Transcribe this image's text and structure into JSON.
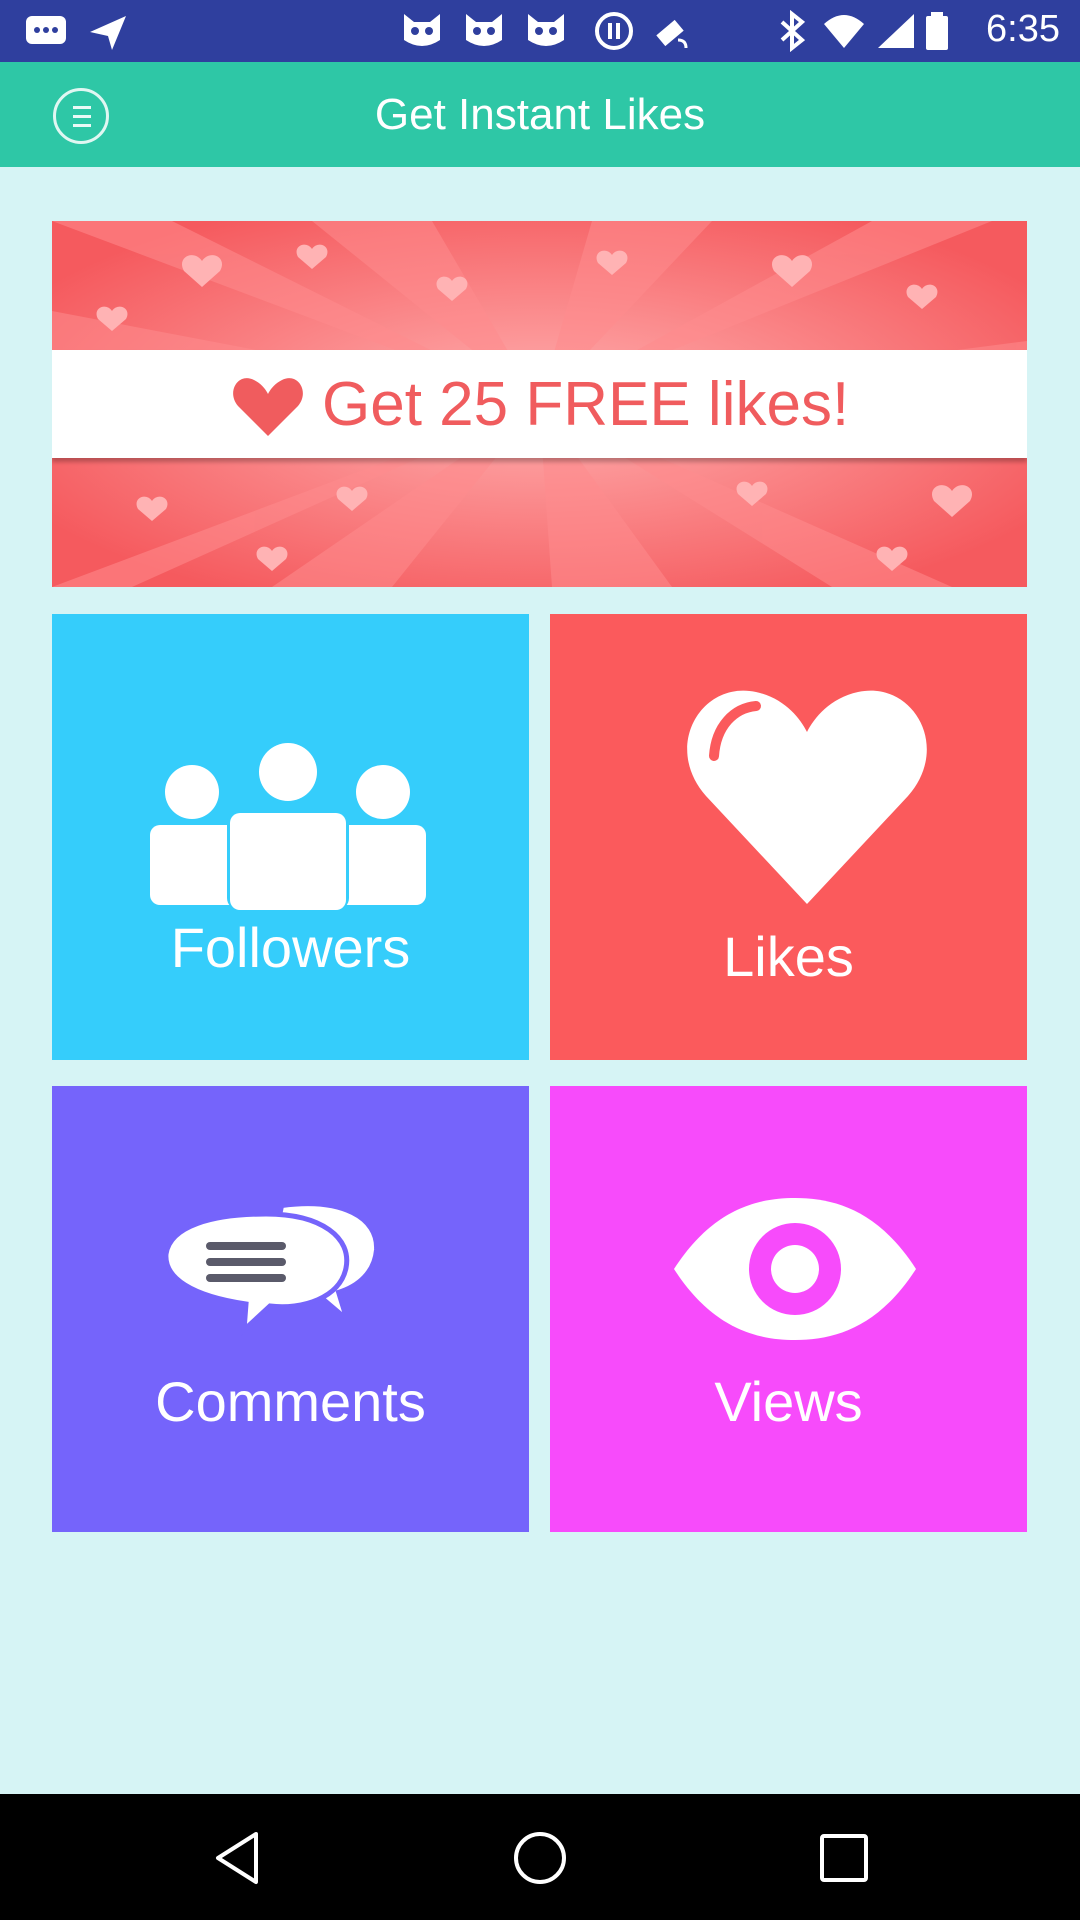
{
  "status_bar": {
    "time": "6:35",
    "icons": [
      "messages-icon",
      "send-icon",
      "cat-icon",
      "cat-icon",
      "cat-icon",
      "media-icon",
      "fake-gps-icon",
      "bluetooth-icon",
      "wifi-icon",
      "signal-icon",
      "battery-icon"
    ]
  },
  "app_bar": {
    "title": "Get Instant Likes",
    "menu_icon": "menu-icon"
  },
  "banner": {
    "text": "Get 25 FREE likes!",
    "icon": "heart-icon",
    "background_color": "#f55a5e"
  },
  "tiles": [
    {
      "label": "Followers",
      "icon": "people-icon",
      "color": "#35cdfb"
    },
    {
      "label": "Likes",
      "icon": "heart-icon",
      "color": "#fb5a5c"
    },
    {
      "label": "Comments",
      "icon": "chat-bubbles-icon",
      "color": "#7564fb"
    },
    {
      "label": "Views",
      "icon": "eye-icon",
      "color": "#f74bfb"
    }
  ],
  "nav_bar": {
    "buttons": [
      "back-icon",
      "home-icon",
      "recents-icon"
    ]
  }
}
